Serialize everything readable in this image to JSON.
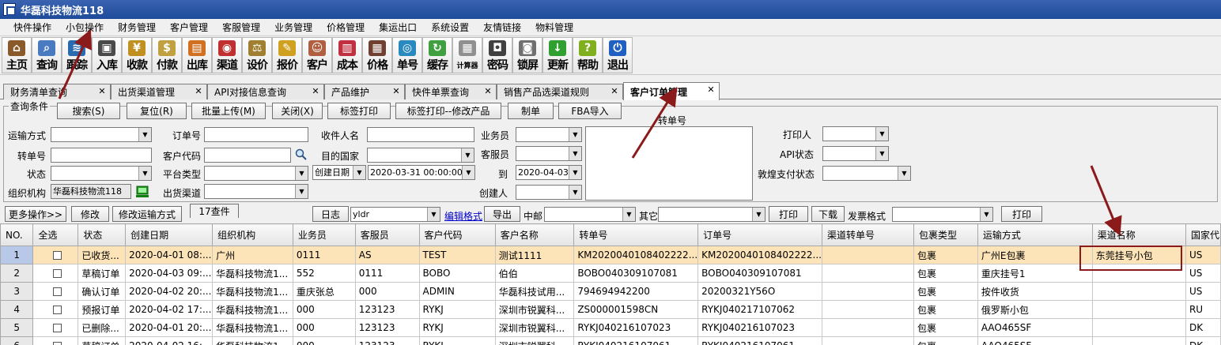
{
  "window": {
    "title": "华磊科技物流118"
  },
  "menu": [
    "快件操作",
    "小包操作",
    "财务管理",
    "客户管理",
    "客服管理",
    "业务管理",
    "价格管理",
    "集运出口",
    "系统设置",
    "友情链接",
    "物料管理"
  ],
  "toolbar": [
    {
      "label": "主页",
      "icon": "home-icon",
      "color": "#8a5a2a"
    },
    {
      "label": "查询",
      "icon": "magnifier-icon",
      "color": "#4a7ac0"
    },
    {
      "label": "跟踪",
      "icon": "signal-icon",
      "color": "#2a6ab0"
    },
    {
      "label": "入库",
      "icon": "truck-icon",
      "color": "#4a4a4a"
    },
    {
      "label": "收款",
      "icon": "yen-icon",
      "color": "#c09020"
    },
    {
      "label": "付款",
      "icon": "money-icon",
      "color": "#c0a040"
    },
    {
      "label": "出库",
      "icon": "box-icon",
      "color": "#d07020"
    },
    {
      "label": "渠道",
      "icon": "channel-icon",
      "color": "#c03030"
    },
    {
      "label": "设价",
      "icon": "scale-icon",
      "color": "#a08030"
    },
    {
      "label": "报价",
      "icon": "quote-icon",
      "color": "#d0a020"
    },
    {
      "label": "客户",
      "icon": "customer-icon",
      "color": "#b06040"
    },
    {
      "label": "成本",
      "icon": "cost-icon",
      "color": "#c03040"
    },
    {
      "label": "价格",
      "icon": "price-icon",
      "color": "#704030"
    },
    {
      "label": "单号",
      "icon": "eye-icon",
      "color": "#2a8ac0"
    },
    {
      "label": "缓存",
      "icon": "refresh-icon",
      "color": "#40a040"
    },
    {
      "label": "计算器",
      "icon": "calculator-icon",
      "color": "#909090"
    },
    {
      "label": "密码",
      "icon": "padlock-icon",
      "color": "#404040"
    },
    {
      "label": "锁屏",
      "icon": "lock-icon",
      "color": "#707070"
    },
    {
      "label": "更新",
      "icon": "download-arrow-icon",
      "color": "#30a030"
    },
    {
      "label": "帮助",
      "icon": "help-icon",
      "color": "#80b020"
    },
    {
      "label": "退出",
      "icon": "power-icon",
      "color": "#2060c0"
    }
  ],
  "tabs": [
    {
      "label": "财务清单查询"
    },
    {
      "label": "出货渠道管理"
    },
    {
      "label": "API对接信息查询"
    },
    {
      "label": "产品维护"
    },
    {
      "label": "快件单票查询"
    },
    {
      "label": "销售产品选渠道规则"
    },
    {
      "label": "客户订单管理",
      "active": true
    }
  ],
  "query": {
    "legend": "查询条件",
    "buttons": [
      "搜索(S)",
      "复位(R)",
      "批量上传(M)",
      "关闭(X)",
      "标签打印",
      "标签打印--修改产品",
      "制单",
      "FBA导入"
    ],
    "labels": {
      "transport": "运输方式",
      "transfer": "转单号",
      "status": "状态",
      "org": "组织机构",
      "orderno": "订单号",
      "custcode": "客户代码",
      "platform": "平台类型",
      "outchannel": "出货渠道",
      "receiver": "收件人名",
      "dest": "目的国家",
      "to": "到",
      "sales": "业务员",
      "cs": "客服员",
      "creator": "创建人",
      "transferbox": "转单号",
      "printer": "打印人",
      "api": "API状态",
      "dunhuang": "敦煌支付状态"
    },
    "values": {
      "org": "华磊科技物流118",
      "datetype": "创建日期",
      "datefrom": "2020-03-31 00:00:00",
      "dateto": "2020-04-03"
    }
  },
  "bar2": {
    "more": "更多操作>>",
    "edit": "修改",
    "edit_transport": "修改运输方式",
    "count": "17查件",
    "log": "日志",
    "user": "yldr",
    "edit_format": "编辑格式",
    "export": "导出",
    "mid": "中邮",
    "other": "其它",
    "print": "打印",
    "download": "下载",
    "invoice": "发票格式",
    "print2": "打印"
  },
  "grid": {
    "columns": [
      "NO.",
      "全选",
      "状态",
      "创建日期",
      "组织机构",
      "业务员",
      "客服员",
      "客户代码",
      "客户名称",
      "转单号",
      "订单号",
      "渠道转单号",
      "包裹类型",
      "运输方式",
      "渠道名称",
      "国家代"
    ],
    "rows": [
      [
        "1",
        "",
        "已收货...",
        "2020-04-01 08:...",
        "广州",
        "0111",
        "AS",
        "TEST",
        "测试1111",
        "KM2020040108402222...",
        "KM2020040108402222...",
        "",
        "包裹",
        "广州E包裹",
        "东莞挂号小包",
        "US"
      ],
      [
        "2",
        "",
        "草稿订单",
        "2020-04-03 09:...",
        "华磊科技物流1...",
        "552",
        "0111",
        "BOBO",
        "伯伯",
        "BOBO040309107081",
        "BOBO040309107081",
        "",
        "包裹",
        "重庆挂号1",
        "",
        "US"
      ],
      [
        "3",
        "",
        "确认订单",
        "2020-04-02 20:...",
        "华磊科技物流1...",
        "重庆张总",
        "000",
        "ADMIN",
        "华磊科技试用...",
        "794694942200",
        "20200321Y56O",
        "",
        "包裹",
        "按件收货",
        "",
        "US"
      ],
      [
        "4",
        "",
        "预报订单",
        "2020-04-02 17:...",
        "华磊科技物流1...",
        "000",
        "123123",
        "RYKJ",
        "深圳市锐翼科...",
        "ZS000001598CN",
        "RYKJ040217107062",
        "",
        "包裹",
        "俄罗斯小包",
        "",
        "RU"
      ],
      [
        "5",
        "",
        "已删除...",
        "2020-04-01 20:...",
        "华磊科技物流1...",
        "000",
        "123123",
        "RYKJ",
        "深圳市锐翼科...",
        "RYKJ040216107023",
        "RYKJ040216107023",
        "",
        "包裹",
        "AAO465SF",
        "",
        "DK"
      ],
      [
        "6",
        "",
        "草稿订单",
        "2020-04-02 16:...",
        "华磊科技物流1...",
        "000",
        "123123",
        "RYKJ",
        "深圳市锐翼科...",
        "RYKJ040216107061",
        "RYKJ040216107061",
        "",
        "包裹",
        "AAO465SF",
        "",
        "DK"
      ]
    ]
  }
}
